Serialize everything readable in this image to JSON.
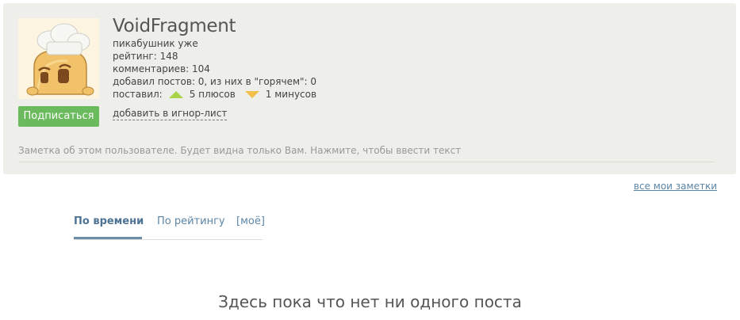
{
  "profile": {
    "username": "VoidFragment",
    "subtitle": "пикабушник уже",
    "rating": "рейтинг: 148",
    "comments": "комментариев: 104",
    "posts": "добавил постов: 0, из них в \"горячем\": 0",
    "votes_prefix": "поставил:",
    "pluses": "5 плюсов",
    "minuses": "1 минусов",
    "subscribe_label": "Подписаться",
    "ignore_label": "добавить в игнор-лист",
    "note_placeholder": "Заметка об этом пользователе. Будет видна только Вам. Нажмите, чтобы ввести текст"
  },
  "notes_link": "все мои заметки",
  "tabs": [
    {
      "label": "По времени",
      "active": true
    },
    {
      "label": "По рейтингу",
      "active": false
    },
    {
      "label": "[моё]",
      "active": false
    }
  ],
  "empty_message": "Здесь пока что нет ни одного поста",
  "colors": {
    "subscribe": "#6bba5d",
    "link": "#5b85a6",
    "panel": "#eeeeea",
    "plus": "#a8d44a",
    "minus": "#f0c04a"
  },
  "icons": {
    "avatar": "chef-avatar-icon",
    "plus": "triangle-up-icon",
    "minus": "triangle-down-icon"
  }
}
